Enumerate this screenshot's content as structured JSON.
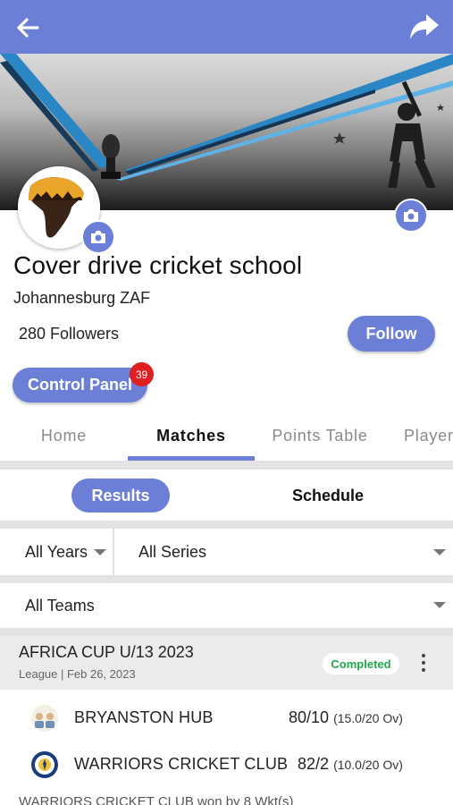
{
  "header": {
    "back_icon": "arrow-left-icon",
    "share_icon": "share-arrow-icon",
    "bar_color": "#6b7fd7"
  },
  "profile": {
    "name": "Cover drive cricket school",
    "location": "Johannesburg ZAF",
    "followers": "280 Followers",
    "follow_label": "Follow",
    "control_panel_label": "Control Panel",
    "notification_count": "39"
  },
  "tabs": [
    {
      "label": "Home",
      "active": false
    },
    {
      "label": "Matches",
      "active": true
    },
    {
      "label": "Points Table",
      "active": false
    },
    {
      "label": "Player",
      "active": false
    }
  ],
  "segments": {
    "results_label": "Results",
    "schedule_label": "Schedule",
    "selected": "Results"
  },
  "filters": {
    "years": "All Years",
    "series": "All Series",
    "teams": "All Teams"
  },
  "match": {
    "title": "AFRICA CUP U/13 2023",
    "subtitle": "League | Feb 26, 2023",
    "status": "Completed",
    "status_color": "#1fa84a",
    "teams": [
      {
        "name": "BRYANSTON HUB",
        "score": "80/10",
        "overs": "(15.0/20 Ov)"
      },
      {
        "name": "WARRIORS CRICKET CLUB",
        "score": "82/2",
        "overs": "(10.0/20 Ov)"
      }
    ],
    "result": "WARRIORS CRICKET CLUB won by 8 Wkt(s)"
  }
}
